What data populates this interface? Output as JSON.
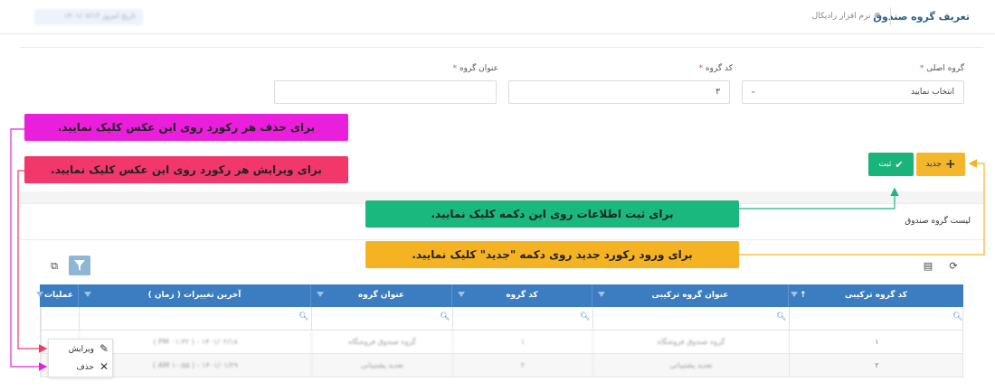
{
  "header": {
    "page_title": "تعریف گروه صندوق",
    "breadcrumb": "# نرم افزار رادیکال",
    "top_pill": "تاریخ امروز ۱۴۰۱/۰۷/۱۳"
  },
  "form": {
    "main_group_label": "گروه اصلی",
    "main_group_value": "انتخاب نمایید",
    "group_code_label": "کد گروه",
    "group_code_value": "۳",
    "group_title_label": "عنوان گروه",
    "group_title_value": "",
    "required_mark": "*"
  },
  "toolbar": {
    "new_label": "جدید",
    "save_label": "ثبت"
  },
  "list": {
    "title": "لیست گروه صندوق"
  },
  "table": {
    "columns": [
      "کد گروه ترکیبی",
      "عنوان گروه ترکیبی",
      "کد گروه",
      "عنوان گروه",
      "آخرین تغییرات ( زمان )",
      "عملیات"
    ],
    "sort_indicator": "↑",
    "rows": [
      {
        "combined_code": "۱",
        "combined_title": "گروه صندوق فروشگاه",
        "group_code": "۱",
        "group_title": "گروه صندوق فروشگاه",
        "last_change": "۱۴۰۱/۰۲/۱۸ - ( PM ۰۱:۳۲ )"
      },
      {
        "combined_code": "۲",
        "combined_title": "تعدید پشتیبانی",
        "group_code": "۲",
        "group_title": "تعدید پشتیبانی",
        "last_change": "۱۴۰۱/۰۱/۲۹ - ( AM ۱۰:۵۵ )"
      }
    ]
  },
  "context_menu": {
    "edit_label": "ویرایش",
    "delete_label": "حذف"
  },
  "callouts": {
    "delete": "برای حذف هر رکورد روی این عکس کلیک نمایید.",
    "edit": "برای ویرایش هر رکورد روی این عکس کلیک نمایید.",
    "save": "برای ثبت اطلاعات روی این دکمه کلیک نمایید.",
    "new": "برای ورود رکورد جدید روی دکمه \"جدید\" کلیک نمایید."
  },
  "colors": {
    "header_blue": "#3b7dc0",
    "save_green": "#19b37b",
    "new_yellow": "#f4b72c",
    "callout_pink": "#ea1fdc",
    "callout_red": "#f2386b"
  }
}
